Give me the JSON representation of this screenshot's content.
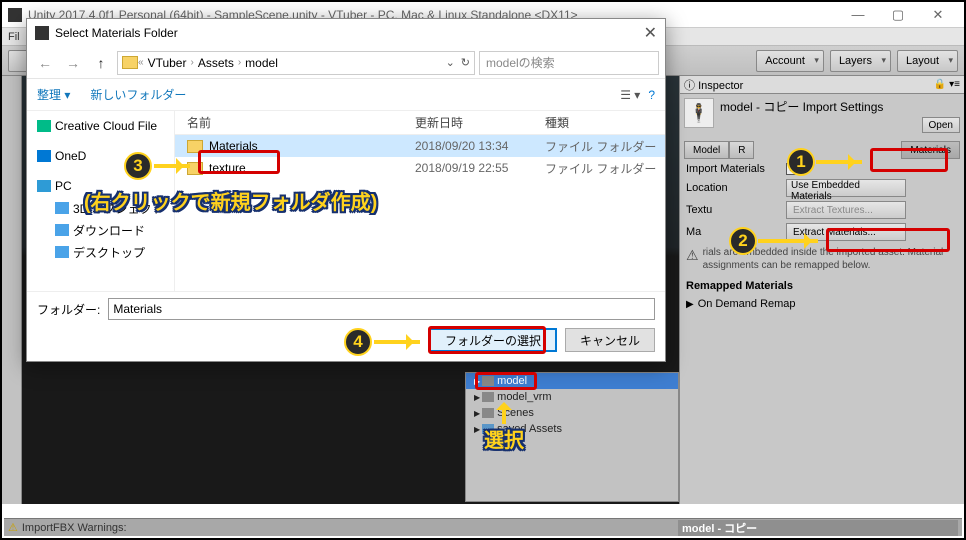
{
  "unity": {
    "title": "Unity 2017.4.0f1 Personal (64bit) - SampleScene.unity - VTuber - PC, Mac & Linux Standalone <DX11>",
    "menu_partial": "Fil",
    "toolbar": {
      "account": "Account",
      "layers": "Layers",
      "layout": "Layout"
    },
    "footer": {
      "warning": "ImportFBX Warnings:",
      "path": "model - コピー"
    }
  },
  "inspector": {
    "tab": "Inspector",
    "object_title": "model - コピー Import Settings",
    "open": "Open",
    "tabs": {
      "model": "Model",
      "rig": "R",
      "materials": "Materials"
    },
    "import_materials": "Import Materials",
    "location": "Location",
    "location_value": "Use Embedded Materials",
    "textures_label": "Textu",
    "extract_textures": "Extract Textures...",
    "materials_label": "Ma",
    "extract_materials": "Extract Materials...",
    "info": "rials are embedded inside the imported asset. Material assignments can be remapped below.",
    "remapped": "Remapped Materials",
    "on_demand": "On Demand Remap"
  },
  "project_tree": {
    "items": [
      {
        "label": "model",
        "selected": true
      },
      {
        "label": "model_vrm"
      },
      {
        "label": "Scenes"
      },
      {
        "label": "saved Assets"
      }
    ]
  },
  "dialog": {
    "title": "Select Materials Folder",
    "breadcrumb": [
      "VTuber",
      "Assets",
      "model"
    ],
    "search_placeholder": "modelの検索",
    "organize": "整理 ▾",
    "new_folder": "新しいフォルダー",
    "columns": {
      "name": "名前",
      "date": "更新日時",
      "type": "種類"
    },
    "files": [
      {
        "name": "Materials",
        "date": "2018/09/20 13:34",
        "type": "ファイル フォルダー",
        "selected": true
      },
      {
        "name": "texture",
        "date": "2018/09/19 22:55",
        "type": "ファイル フォルダー"
      }
    ],
    "sidebar": [
      {
        "label": "Creative Cloud File",
        "kind": "cloud"
      },
      {
        "label": "OneD",
        "kind": "onedrive"
      },
      {
        "label": "PC",
        "kind": "pc"
      },
      {
        "label": "3D オブジェクト",
        "kind": "sub"
      },
      {
        "label": "ダウンロード",
        "kind": "sub"
      },
      {
        "label": "デスクトップ",
        "kind": "sub"
      }
    ],
    "folder_label": "フォルダー:",
    "folder_value": "Materials",
    "select_btn": "フォルダーの選択",
    "cancel_btn": "キャンセル"
  },
  "annotations": {
    "note3": "(右クリックで新規フォルダ作成)",
    "note_select": "選択"
  }
}
